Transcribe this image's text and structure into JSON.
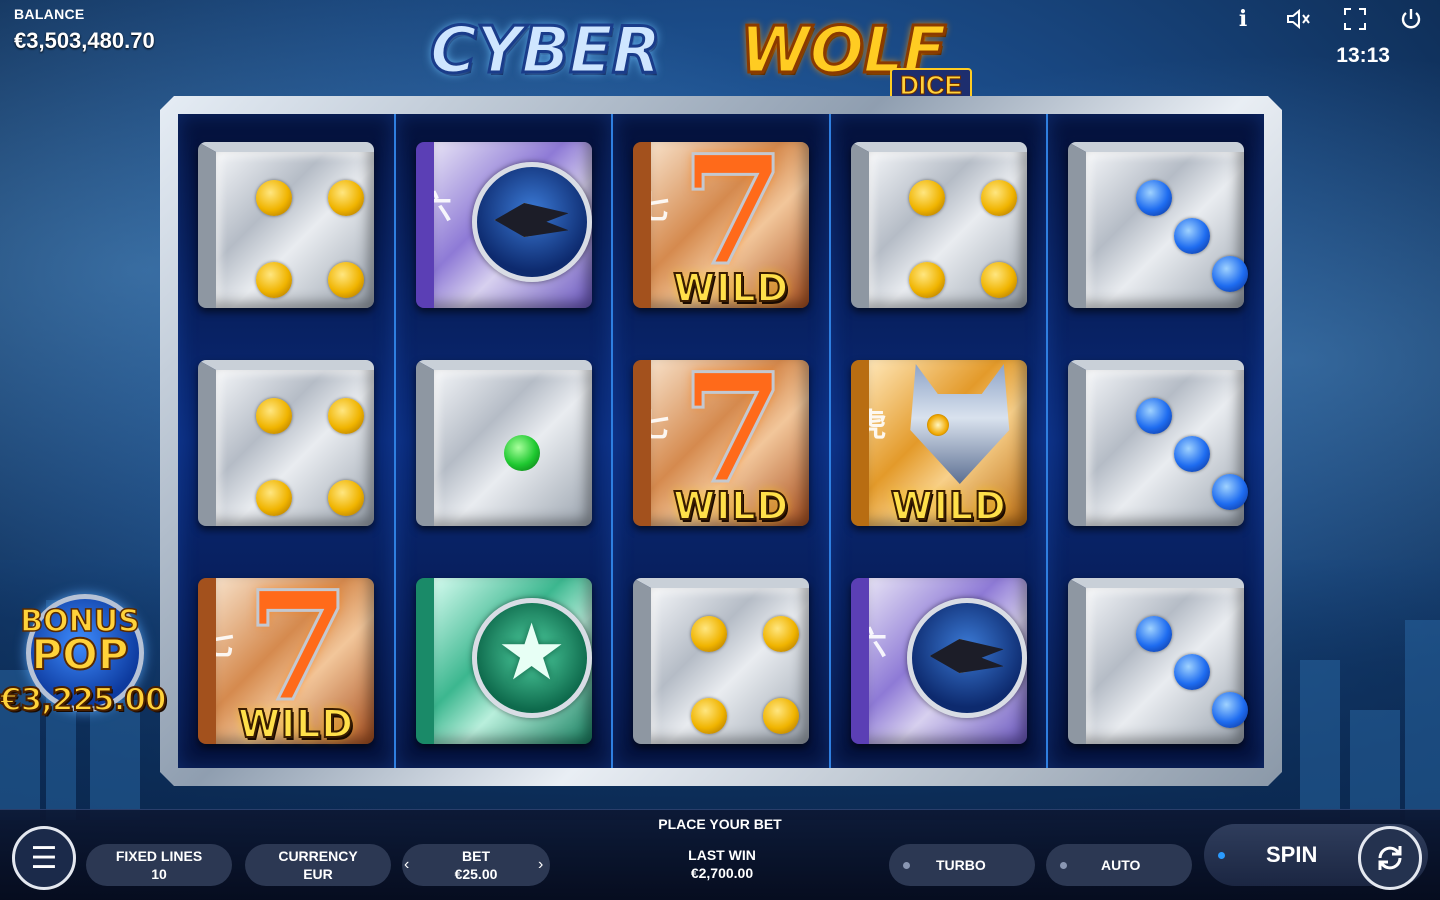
{
  "balance": {
    "label": "BALANCE",
    "value": "€3,503,480.70"
  },
  "clock": "13:13",
  "top_icons": [
    "info-icon",
    "sound-muted-icon",
    "fullscreen-icon",
    "power-icon"
  ],
  "logo": {
    "part1": "CYBER",
    "part2": "WOLF",
    "sub": "DICE"
  },
  "bonus_pop": {
    "line1": "BONUS",
    "line2": "POP",
    "amount": "€3,225.00"
  },
  "reels": [
    [
      {
        "type": "die",
        "pips": 4,
        "color": "gold"
      },
      {
        "type": "die",
        "pips": 4,
        "color": "gold"
      },
      {
        "type": "seven",
        "kanji": "七",
        "label": "WILD"
      }
    ],
    [
      {
        "type": "ship",
        "kanji": "六"
      },
      {
        "type": "die",
        "pips": 1,
        "color": "green"
      },
      {
        "type": "star"
      }
    ],
    [
      {
        "type": "seven",
        "kanji": "七",
        "label": "WILD"
      },
      {
        "type": "seven",
        "kanji": "七",
        "label": "WILD"
      },
      {
        "type": "die",
        "pips": 4,
        "color": "gold"
      }
    ],
    [
      {
        "type": "die",
        "pips": 4,
        "color": "gold"
      },
      {
        "type": "wolf",
        "kanji": "虎",
        "label": "WILD"
      },
      {
        "type": "ship",
        "kanji": "六"
      }
    ],
    [
      {
        "type": "die",
        "pips": 3,
        "color": "blue"
      },
      {
        "type": "die",
        "pips": 3,
        "color": "blue"
      },
      {
        "type": "die",
        "pips": 3,
        "color": "blue"
      }
    ]
  ],
  "controls": {
    "place_bet": "PLACE YOUR BET",
    "fixed_lines_label": "FIXED LINES",
    "fixed_lines_value": "10",
    "currency_label": "CURRENCY",
    "currency_value": "EUR",
    "bet_label": "BET",
    "bet_value": "€25.00",
    "bet_prev": "‹",
    "bet_next": "›",
    "last_win_label": "LAST WIN",
    "last_win_value": "€2,700.00",
    "turbo": "TURBO",
    "auto": "AUTO",
    "spin": "SPIN"
  },
  "colors": {
    "accent": "#2f7fe0",
    "gold": "#ffd23a",
    "bar": "#2c3853"
  }
}
